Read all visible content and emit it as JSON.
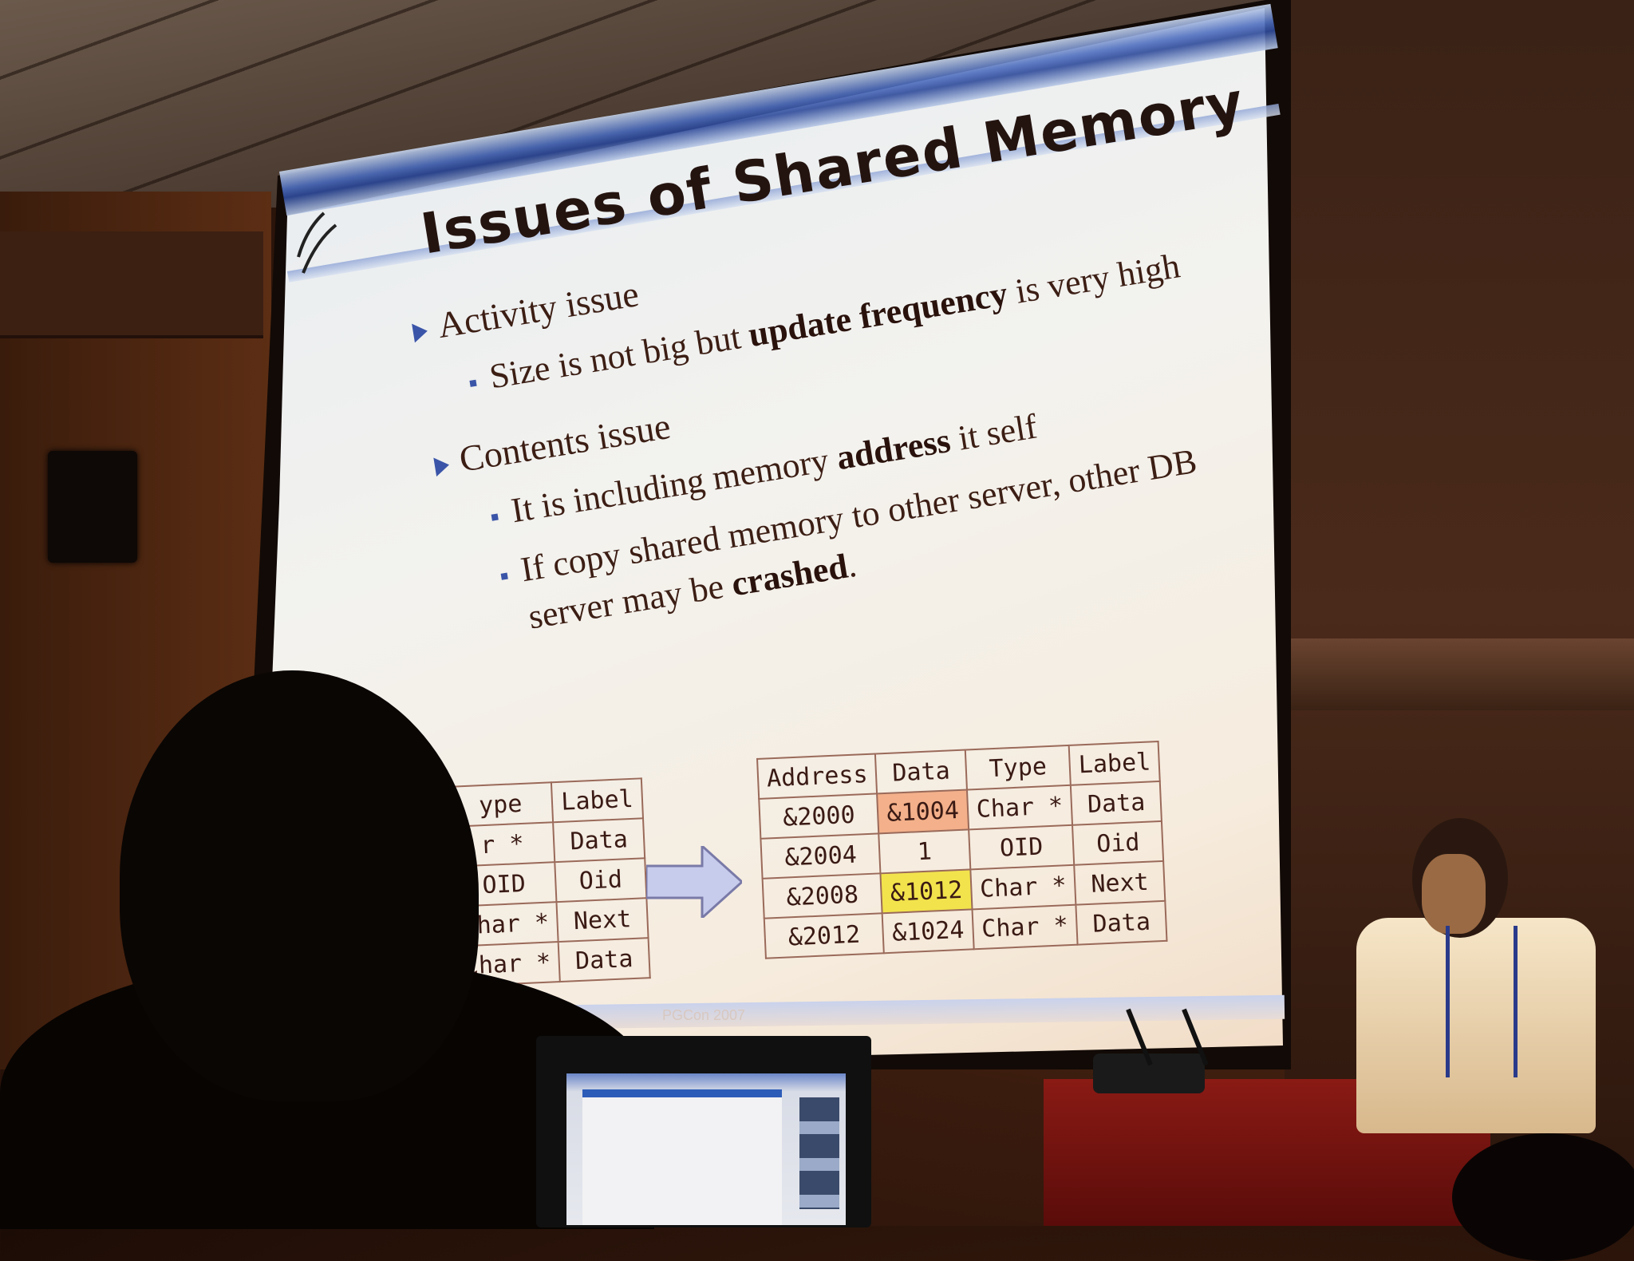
{
  "slide": {
    "title": "Issues of Shared Memory",
    "bullets": [
      {
        "heading": "Activity issue",
        "subs": [
          {
            "pre": "Size is not big but ",
            "bold": "update frequency",
            "post": " is very high"
          }
        ]
      },
      {
        "heading": "Contents issue",
        "subs": [
          {
            "pre": "It is including memory ",
            "bold": "address",
            "post": " it self"
          },
          {
            "pre": "If copy shared memory to other server, other DB",
            "bold": "",
            "post": ""
          },
          {
            "pre": "server may be ",
            "bold": "crashed",
            "post": "."
          }
        ]
      }
    ],
    "table_left": {
      "headers": [
        "ype",
        "Label"
      ],
      "rows": [
        [
          "r *",
          "Data"
        ],
        [
          "OID",
          "Oid"
        ],
        [
          "Char *",
          "Next"
        ],
        [
          "Char *",
          "Data"
        ]
      ]
    },
    "table_right": {
      "headers": [
        "Address",
        "Data",
        "Type",
        "Label"
      ],
      "rows": [
        [
          "&2000",
          "&1004",
          "Char *",
          "Data"
        ],
        [
          "&2004",
          "1",
          "OID",
          "Oid"
        ],
        [
          "&2008",
          "&1012",
          "Char *",
          "Next"
        ],
        [
          "&2012",
          "&1024",
          "Char *",
          "Data"
        ]
      ]
    },
    "footer": "PGCon 2007",
    "colors": {
      "title_band": "#2e4a9a",
      "bullet_marker": "#3a55a8",
      "highlight_orange": "#f3b08a",
      "highlight_yellow": "#f2e34c"
    }
  }
}
